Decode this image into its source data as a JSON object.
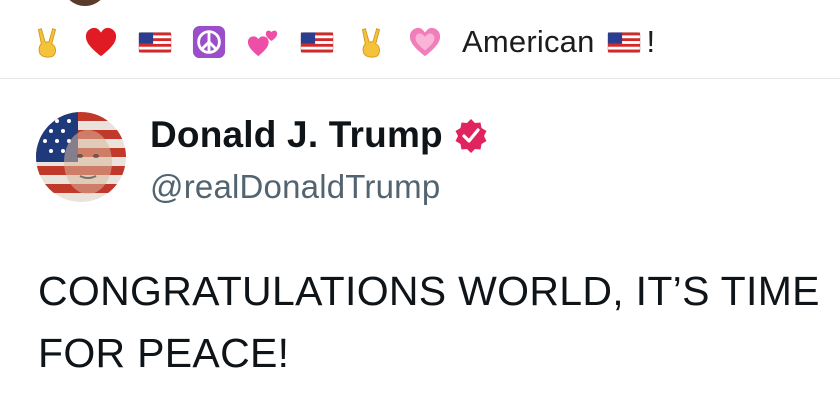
{
  "caption": {
    "emojis_before": [
      {
        "icon": "victory-hand-icon"
      },
      {
        "icon": "red-heart-icon"
      },
      {
        "icon": "us-flag-icon"
      },
      {
        "icon": "peace-symbol-icon"
      },
      {
        "icon": "two-hearts-icon"
      },
      {
        "icon": "us-flag-icon"
      },
      {
        "icon": "victory-hand-icon"
      },
      {
        "icon": "sparkling-heart-icon"
      }
    ],
    "text": "American",
    "emoji_after": "us-flag-icon",
    "trailing": "!"
  },
  "tweet": {
    "author_name": "Donald J. Trump",
    "verified_badge": "verified-badge-icon",
    "handle": "@realDonaldTrump",
    "body": "CONGRATULATIONS WORLD, IT’S TIME FOR PEACE!"
  },
  "colors": {
    "verified_badge": "#e0245e",
    "handle": "#536471",
    "text": "#0f1419"
  }
}
